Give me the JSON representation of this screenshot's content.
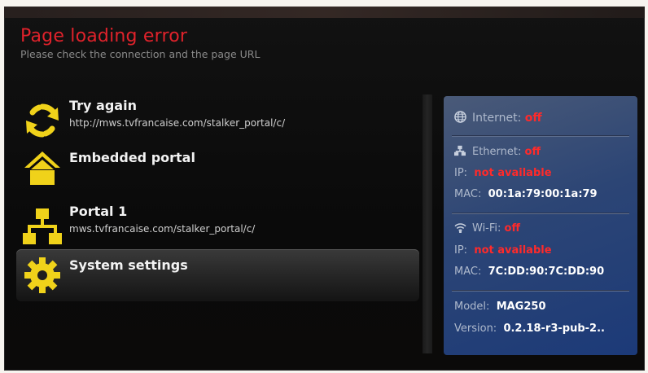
{
  "header": {
    "title": "Page loading error",
    "subtitle": "Please check the connection and the page URL"
  },
  "menu": {
    "items": [
      {
        "label": "Try again",
        "sub": "http://mws.tvfrancaise.com/stalker_portal/c/",
        "icon": "refresh-icon"
      },
      {
        "label": "Embedded portal",
        "sub": "",
        "icon": "home-icon"
      },
      {
        "label": "Portal 1",
        "sub": "mws.tvfrancaise.com/stalker_portal/c/",
        "icon": "network-icon"
      },
      {
        "label": "System settings",
        "sub": "",
        "icon": "gear-icon",
        "selected": true
      }
    ]
  },
  "status": {
    "internet_label": "Internet:",
    "internet_value": "off",
    "ethernet_label": "Ethernet:",
    "ethernet_value": "off",
    "eth_ip_label": "IP:",
    "eth_ip_value": "not available",
    "eth_mac_label": "MAC:",
    "eth_mac_value": "00:1a:79:00:1a:79",
    "wifi_label": "Wi-Fi:",
    "wifi_value": "off",
    "wifi_ip_label": "IP:",
    "wifi_ip_value": "not available",
    "wifi_mac_label": "MAC:",
    "wifi_mac_value": "7C:DD:90:7C:DD:90",
    "model_label": "Model:",
    "model_value": "MAG250",
    "version_label": "Version:",
    "version_value": "0.2.18-r3-pub-2.."
  },
  "colors": {
    "error_red": "#e0222b",
    "icon_yellow": "#f0d21a",
    "panel_blue": "#1c3a78"
  }
}
